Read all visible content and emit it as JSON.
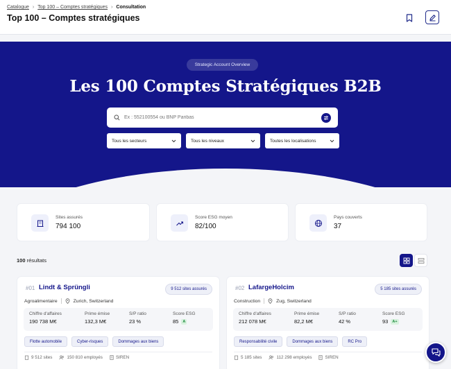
{
  "breadcrumb": {
    "items": [
      "Catalogue",
      "Top 100 – Comptes stratégiques",
      "Consultation"
    ]
  },
  "header": {
    "title": "Top 100 – Comptes stratégiques"
  },
  "hero": {
    "badge": "Strategic Account Overview",
    "title": "Les 100 Comptes Stratégiques B2B",
    "search_placeholder": "Ex : 552100554 ou BNP Paribas",
    "filters": [
      "Tous les secteurs",
      "Tous les niveaux",
      "Toutes les localisations"
    ]
  },
  "stats": [
    {
      "label": "Sites assurés",
      "value": "794 100",
      "icon": "building-icon"
    },
    {
      "label": "Score ESG moyen",
      "value": "82/100",
      "icon": "trend-up-icon"
    },
    {
      "label": "Pays couverts",
      "value": "37",
      "icon": "globe-icon"
    }
  ],
  "results": {
    "count": "100",
    "label": " résultats"
  },
  "cards": [
    {
      "num": "#01",
      "name": "Lindt & Sprüngli",
      "sites_pill": "9 512 sites assurés",
      "sector": "Agroalimentaire",
      "location": "Zurich, Switzerland",
      "metrics": [
        {
          "label": "Chiffre d'affaires",
          "value": "190 738 M€"
        },
        {
          "label": "Prime émise",
          "value": "132,3 M€"
        },
        {
          "label": "S/P ratio",
          "value": "23 %"
        },
        {
          "label": "Score ESG",
          "value": "85",
          "grade": "A"
        }
      ],
      "tags": [
        "Flotte automobile",
        "Cyber-risques",
        "Dommages aux biens"
      ],
      "footer": {
        "sites": "9 512 sites",
        "employees": "150 810 employés",
        "id": "SIREN"
      }
    },
    {
      "num": "#02",
      "name": "LafargeHolcim",
      "sites_pill": "5 185 sites assurés",
      "sector": "Construction",
      "location": "Zug, Switzerland",
      "metrics": [
        {
          "label": "Chiffre d'affaires",
          "value": "212 078 M€"
        },
        {
          "label": "Prime émise",
          "value": "82,2 M€"
        },
        {
          "label": "S/P ratio",
          "value": "42 %"
        },
        {
          "label": "Score ESG",
          "value": "93",
          "grade": "A+"
        }
      ],
      "tags": [
        "Responsabilité civile",
        "Dommages aux biens",
        "RC Pro"
      ],
      "footer": {
        "sites": "5 185 sites",
        "employees": "112 298 employés",
        "id": "SIREN"
      }
    }
  ],
  "colors": {
    "brand": "#14168a",
    "background": "#f4f5f8",
    "esg_grade": "#1a8a3c"
  }
}
